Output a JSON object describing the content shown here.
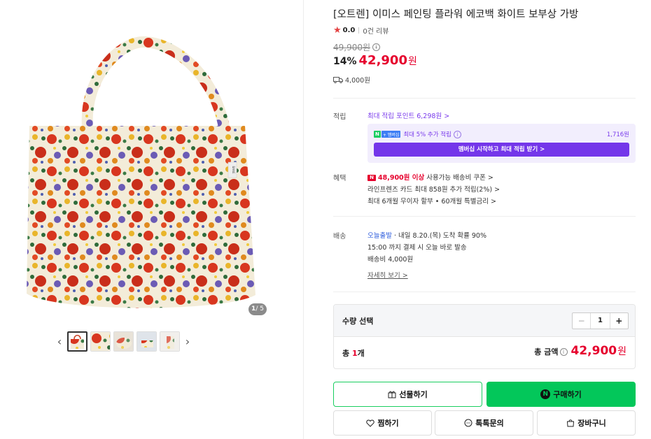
{
  "product": {
    "title": "[오트렌] 이미스 페인팅 플라워 에코백 화이트 보부상 가방",
    "rating_score": "0.0",
    "review_count": "0건 리뷰",
    "original_price": "49,900원",
    "discount_pct": "14%",
    "sale_price": "42,900",
    "currency": "원",
    "shipping_fee": "4,000원"
  },
  "gallery": {
    "counter_current": "1",
    "counter_total": "/ 5",
    "prev_icon": "chevron-left-icon",
    "next_icon": "chevron-right-icon",
    "thumbnails": 5,
    "bag_label": "BANE"
  },
  "points": {
    "label": "적립",
    "max_points": "최대 적립 포인트 6,298원 >",
    "n_badge": "N",
    "plus_badge": "+ 멤버십",
    "membership_text": "최대 5% 추가 적립",
    "membership_amount": "1,716원",
    "membership_button": "멤버십 시작하고 최대 적립 받기 >"
  },
  "benefits": {
    "label": "혜택",
    "coupon_badge": "N",
    "coupon_highlight": "48,900원 이상",
    "coupon_rest": " 사용가능 배송비 쿠폰 >",
    "card_point": "라인프렌즈 카드 최대 858원 추가 적립(2%) >",
    "installment": "최대 6개월 무이자 할부 • 60개월 특별금리 >"
  },
  "delivery": {
    "label": "배송",
    "today": "오늘출발",
    "arrival": "· 내일 8.20.(목) 도착 확률 90%",
    "cutoff": "15:00 까지 결제 시 오늘 바로 발송",
    "fee": "배송비 4,000원",
    "detail_link": "자세히 보기 >"
  },
  "quantity": {
    "label": "수량 선택",
    "minus": "−",
    "value": "1",
    "plus": "+",
    "total_prefix": "총 ",
    "total_count": "1",
    "total_suffix": "개",
    "sum_label": "총 금액",
    "sum_price": "42,900",
    "sum_currency": "원"
  },
  "buttons": {
    "gift": "선물하기",
    "buy": "구매하기",
    "buy_logo": "N",
    "wish": "찜하기",
    "talk": "톡톡문의",
    "cart": "장바구니"
  },
  "colors": {
    "sale_red": "#e6002d",
    "naver_green": "#03c75a",
    "membership_purple": "#7436ea"
  }
}
